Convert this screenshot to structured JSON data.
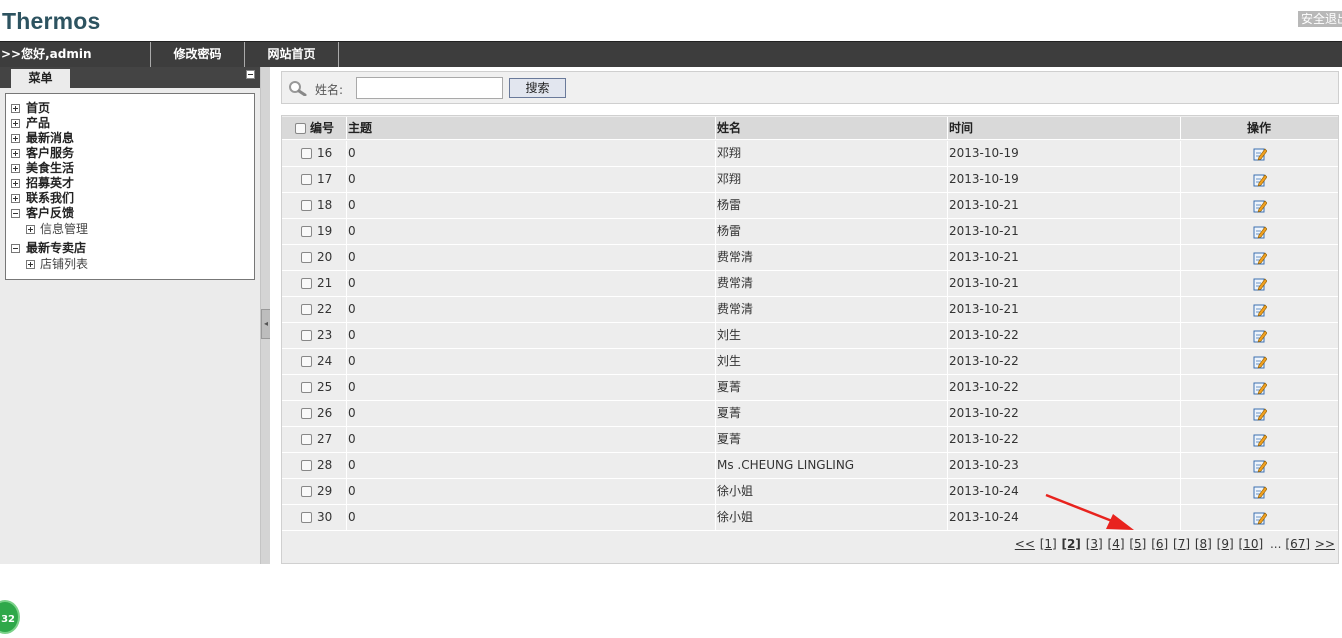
{
  "header": {
    "logo": "Thermos",
    "logout_label": "安全退出"
  },
  "nav": {
    "greeting": ">>您好,admin",
    "change_password": "修改密码",
    "site_home": "网站首页"
  },
  "sidebar": {
    "menu_tab": "菜单",
    "items": [
      {
        "label": "首页",
        "state": "collapsed"
      },
      {
        "label": "产品",
        "state": "collapsed"
      },
      {
        "label": "最新消息",
        "state": "collapsed"
      },
      {
        "label": "客户服务",
        "state": "collapsed"
      },
      {
        "label": "美食生活",
        "state": "collapsed"
      },
      {
        "label": "招募英才",
        "state": "collapsed"
      },
      {
        "label": "联系我们",
        "state": "collapsed"
      },
      {
        "label": "客户反馈",
        "state": "expanded",
        "children": [
          "信息管理"
        ]
      },
      {
        "label": "最新专卖店",
        "state": "expanded",
        "children": [
          "店铺列表"
        ]
      }
    ]
  },
  "search": {
    "label": "姓名:",
    "value": "",
    "button": "搜索"
  },
  "table": {
    "headers": {
      "id": "编号",
      "subject": "主题",
      "name": "姓名",
      "time": "时间",
      "action": "操作"
    },
    "rows": [
      {
        "id": "16",
        "subject": "0",
        "name": "邓翔",
        "time": "2013-10-19"
      },
      {
        "id": "17",
        "subject": "0",
        "name": "邓翔",
        "time": "2013-10-19"
      },
      {
        "id": "18",
        "subject": "0",
        "name": "杨雷",
        "time": "2013-10-21"
      },
      {
        "id": "19",
        "subject": "0",
        "name": "杨雷",
        "time": "2013-10-21"
      },
      {
        "id": "20",
        "subject": "0",
        "name": "费常清",
        "time": "2013-10-21"
      },
      {
        "id": "21",
        "subject": "0",
        "name": "费常清",
        "time": "2013-10-21"
      },
      {
        "id": "22",
        "subject": "0",
        "name": "费常清",
        "time": "2013-10-21"
      },
      {
        "id": "23",
        "subject": "0",
        "name": "刘生",
        "time": "2013-10-22"
      },
      {
        "id": "24",
        "subject": "0",
        "name": "刘生",
        "time": "2013-10-22"
      },
      {
        "id": "25",
        "subject": "0",
        "name": "夏菁",
        "time": "2013-10-22"
      },
      {
        "id": "26",
        "subject": "0",
        "name": "夏菁",
        "time": "2013-10-22"
      },
      {
        "id": "27",
        "subject": "0",
        "name": "夏菁",
        "time": "2013-10-22"
      },
      {
        "id": "28",
        "subject": "0",
        "name": "Ms .CHEUNG LINGLING",
        "time": "2013-10-23"
      },
      {
        "id": "29",
        "subject": "0",
        "name": "徐小姐",
        "time": "2013-10-24"
      },
      {
        "id": "30",
        "subject": "0",
        "name": "徐小姐",
        "time": "2013-10-24"
      }
    ]
  },
  "pager": {
    "first": "<<",
    "pages": [
      "[1]",
      "[2]",
      "[3]",
      "[4]",
      "[5]",
      "[6]",
      "[7]",
      "[8]",
      "[9]",
      "[10]"
    ],
    "current": "[2]",
    "ellipsis": "...",
    "last_page": "[67]",
    "last": ">>"
  },
  "badge": {
    "count": "32"
  },
  "colors": {
    "nav_bg": "#3d3d3d",
    "logo": "#2d5360",
    "annotation_arrow": "#e8231e",
    "badge": "#2fa84a"
  }
}
